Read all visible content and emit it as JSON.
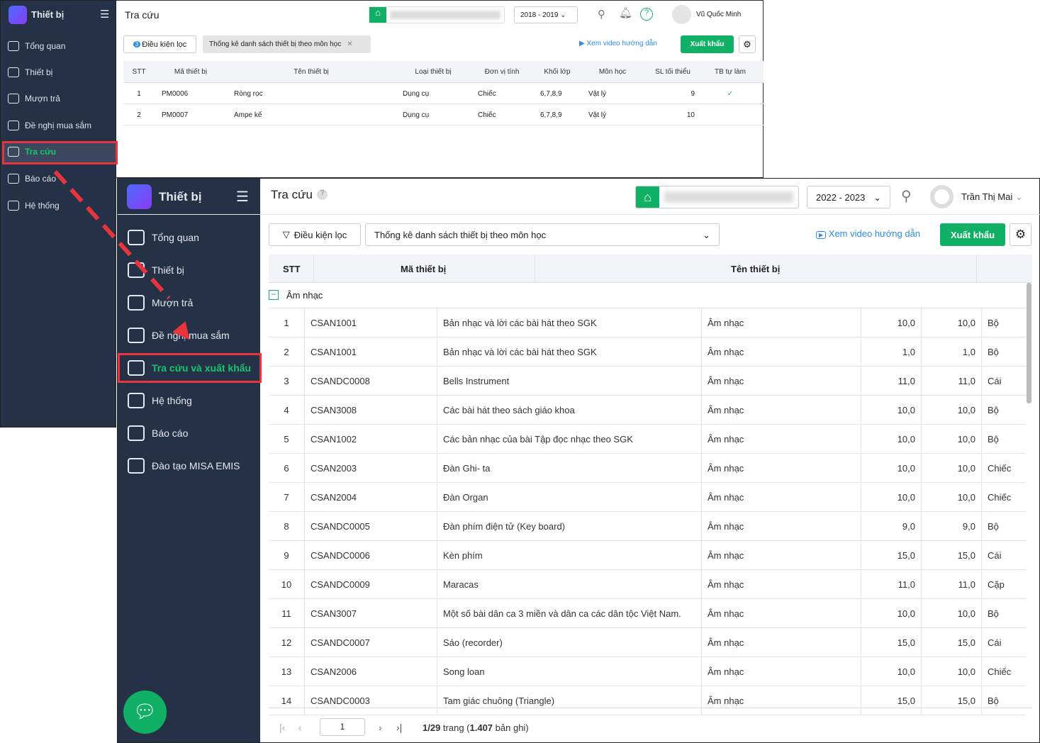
{
  "old": {
    "app_title": "Thiết bị",
    "page_title": "Tra cứu",
    "year": "2018 - 2019",
    "user": "Vũ Quốc Minh",
    "sidebar": [
      "Tổng quan",
      "Thiết bị",
      "Mượn trả",
      "Đề nghị mua sắm",
      "Tra cứu",
      "Báo cáo",
      "Hệ thống"
    ],
    "filter_label": "Điều kiện lọc",
    "filter_badge": "3",
    "report_tag": "Thống kê danh sách thiết bị theo môn học",
    "video_link": "Xem video hướng dẫn",
    "export": "Xuất khẩu",
    "columns": [
      "STT",
      "Mã thiết bị",
      "Tên thiết bị",
      "Loại thiết bị",
      "Đơn vị tính",
      "Khối lớp",
      "Môn học",
      "SL tối thiểu",
      "TB tự làm"
    ],
    "rows": [
      [
        "1",
        "PM0006",
        "Ròng rọc",
        "Dụng cụ",
        "Chiếc",
        "6,7,8,9",
        "Vật lý",
        "9",
        "✓"
      ],
      [
        "2",
        "PM0007",
        "Ampe kế",
        "Dụng cụ",
        "Chiếc",
        "6,7,8,9",
        "Vật lý",
        "10",
        ""
      ]
    ]
  },
  "new": {
    "app_title": "Thiết bị",
    "page_title": "Tra cứu",
    "year": "2022 - 2023",
    "user": "Trần Thị Mai",
    "sidebar": [
      "Tổng quan",
      "Thiết bị",
      "Mượn trả",
      "Đề nghị mua sắm",
      "Tra cứu và xuất khẩu",
      "Hệ thống",
      "Báo cáo",
      "Đào tạo MISA EMIS"
    ],
    "filter_label": "Điều kiện lọc",
    "report_select": "Thống kê danh sách thiết bị theo môn học",
    "video_link": "Xem video hướng dẫn",
    "export": "Xuất khẩu",
    "columns": [
      "STT",
      "Mã thiết bị",
      "Tên thiết bị"
    ],
    "group": "Âm nhạc",
    "rows": [
      [
        "1",
        "CSAN1001",
        "Bản nhạc và lời các bài hát theo SGK",
        "Âm nhạc",
        "10,0",
        "10,0",
        "Bộ"
      ],
      [
        "2",
        "CSAN1001",
        "Bản nhạc và lời các bài hát theo SGK",
        "Âm nhạc",
        "1,0",
        "1,0",
        "Bộ"
      ],
      [
        "3",
        "CSANDC0008",
        "Bells Instrument",
        "Âm nhạc",
        "11,0",
        "11,0",
        "Cái"
      ],
      [
        "4",
        "CSAN3008",
        "Các bài hát theo sách giáo khoa",
        "Âm nhạc",
        "10,0",
        "10,0",
        "Bộ"
      ],
      [
        "5",
        "CSAN1002",
        "Các bản nhạc của bài Tập đọc nhạc theo SGK",
        "Âm nhạc",
        "10,0",
        "10,0",
        "Bộ"
      ],
      [
        "6",
        "CSAN2003",
        "Đàn Ghi- ta",
        "Âm nhạc",
        "10,0",
        "10,0",
        "Chiếc"
      ],
      [
        "7",
        "CSAN2004",
        "Đàn Organ",
        "Âm nhạc",
        "10,0",
        "10,0",
        "Chiếc"
      ],
      [
        "8",
        "CSANDC0005",
        "Đàn phím điện tử (Key board)",
        "Âm nhạc",
        "9,0",
        "9,0",
        "Bộ"
      ],
      [
        "9",
        "CSANDC0006",
        "Kèn phím",
        "Âm nhạc",
        "15,0",
        "15,0",
        "Cái"
      ],
      [
        "10",
        "CSANDC0009",
        "Maracas",
        "Âm nhạc",
        "11,0",
        "11,0",
        "Cặp"
      ],
      [
        "11",
        "CSAN3007",
        "Một số bài dân ca 3 miền và dân ca các dân tộc Việt Nam.",
        "Âm nhạc",
        "10,0",
        "10,0",
        "Bộ"
      ],
      [
        "12",
        "CSANDC0007",
        "Sáo (recorder)",
        "Âm nhạc",
        "15,0",
        "15,0",
        "Cái"
      ],
      [
        "13",
        "CSAN2006",
        "Song loan",
        "Âm nhạc",
        "10,0",
        "10,0",
        "Chiếc"
      ],
      [
        "14",
        "CSANDC0003",
        "Tam giác chuông (Triangle)",
        "Âm nhạc",
        "15,0",
        "15,0",
        "Bộ"
      ]
    ],
    "pager": {
      "page": "1",
      "pages": "1/29",
      "trang": " trang (",
      "total": "1.407",
      "suffix": " bản ghi)"
    }
  },
  "colors": {
    "accent": "#10b065",
    "sidebar": "#253147",
    "highlight": "#e8343c"
  }
}
